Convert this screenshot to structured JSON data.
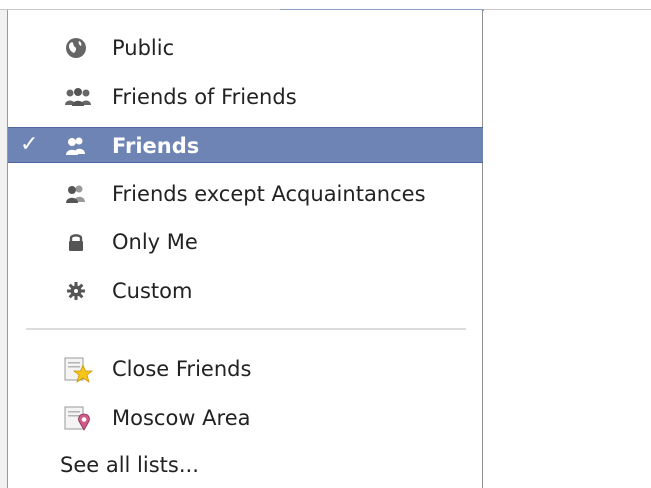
{
  "menu": {
    "items": [
      {
        "label": "Public",
        "icon": "globe-icon",
        "selected": false
      },
      {
        "label": "Friends of Friends",
        "icon": "friends-of-friends-icon",
        "selected": false
      },
      {
        "label": "Friends",
        "icon": "friends-icon",
        "selected": true
      },
      {
        "label": "Friends except Acquaintances",
        "icon": "friends-except-icon",
        "selected": false
      },
      {
        "label": "Only Me",
        "icon": "lock-icon",
        "selected": false
      },
      {
        "label": "Custom",
        "icon": "gear-icon",
        "selected": false
      }
    ],
    "lists": [
      {
        "label": "Close Friends",
        "icon": "star-list-icon"
      },
      {
        "label": "Moscow Area",
        "icon": "location-list-icon"
      }
    ],
    "see_all_label": "See all lists...",
    "check_mark": "✓"
  },
  "colors": {
    "selected_bg": "#6d84b4",
    "icon_gray": "#666666",
    "text": "#222222"
  }
}
